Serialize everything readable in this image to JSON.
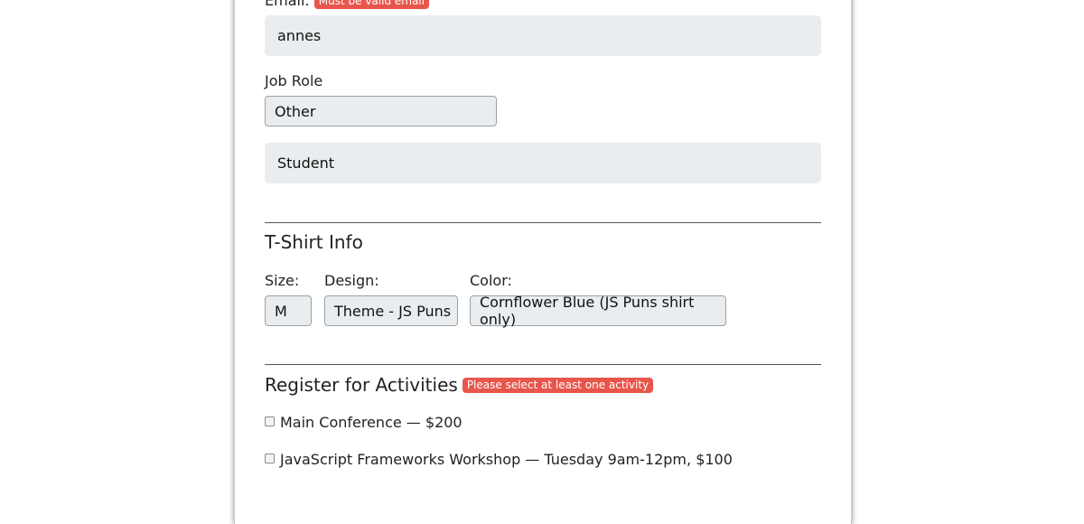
{
  "form": {
    "email": {
      "label": "Email:",
      "error": "Must be valid email",
      "value": "annes"
    },
    "job_role": {
      "label": "Job Role",
      "selected": "Other",
      "other_value": "Student"
    },
    "tshirt": {
      "title": "T-Shirt Info",
      "size_label": "Size:",
      "size_value": "M",
      "design_label": "Design:",
      "design_value": "Theme - JS Puns",
      "color_label": "Color:",
      "color_value": "Cornflower Blue (JS Puns shirt only)"
    },
    "activities": {
      "title": "Register for Activities",
      "error": "Please select at least one activity",
      "items": [
        {
          "label": "Main Conference — $200",
          "checked": false
        },
        {
          "label": "JavaScript Frameworks Workshop — Tuesday 9am-12pm, $100",
          "checked": false
        }
      ]
    }
  },
  "colors": {
    "error_badge": "#e8564b",
    "input_bg": "#e9edef",
    "rule": "#555555"
  }
}
